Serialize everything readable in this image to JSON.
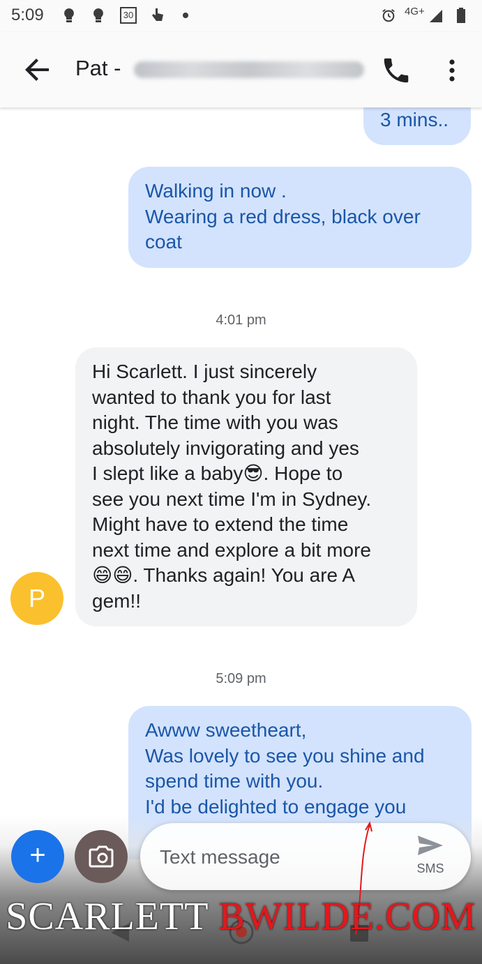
{
  "status_bar": {
    "time": "5:09",
    "calendar_day": "30",
    "network": "4G+",
    "icons": [
      "lightbulb-icon",
      "lightbulb-icon",
      "calendar-icon",
      "touch-icon",
      "dot-icon",
      "alarm-icon",
      "signal-icon",
      "battery-icon"
    ]
  },
  "app_bar": {
    "contact_name": "Pat -",
    "icons": [
      "back-arrow-icon",
      "phone-icon",
      "more-vert-icon"
    ]
  },
  "messages": [
    {
      "direction": "outgoing",
      "text": "3 mins.."
    },
    {
      "direction": "outgoing",
      "text": "Walking in now .\nWearing a red dress, black over\ncoat"
    },
    {
      "timestamp": "4:01 pm"
    },
    {
      "direction": "incoming",
      "text": "Hi Scarlett. I just sincerely\nwanted to thank you for last\nnight. The time with you was\nabsolutely invigorating and yes\nI slept like a baby😎. Hope to\nsee you next time I'm in Sydney.\nMight have to extend the time\nnext time and explore a bit more\n😄😄. Thanks again! You are A\ngem!!"
    },
    {
      "timestamp": "5:09 pm"
    },
    {
      "direction": "outgoing",
      "text": "Awww sweetheart,\nWas lovely to see you shine and\nspend time with you.\nI'd be delighted to engage you"
    }
  ],
  "avatar_letter": "P",
  "colors": {
    "outgoing_bubble": "#d3e3fd",
    "outgoing_text": "#1a56a8",
    "incoming_bubble": "#f1f3f4",
    "avatar": "#fbc02d",
    "fab": "#1a73e8",
    "watermark_red": "#e3181c"
  },
  "compose": {
    "add_label": "+",
    "placeholder": "Text message",
    "send_label": "SMS"
  },
  "watermark": {
    "part1": "SCARLETT",
    "part2": "BWILDE",
    "part3": ".COM"
  }
}
